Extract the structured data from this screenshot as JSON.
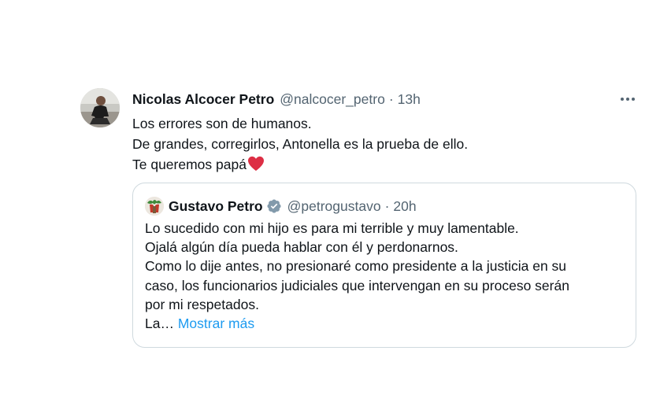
{
  "tweet": {
    "author_name": "Nicolas Alcocer Petro",
    "author_handle": "@nalcocer_petro",
    "separator": "·",
    "time": "13h",
    "lines": [
      "Los errores son de humanos.",
      "De grandes, corregirlos, Antonella es la prueba de ello.",
      "Te queremos papá"
    ],
    "emoji": "heart-icon"
  },
  "quote": {
    "author_name": "Gustavo Petro",
    "author_handle": "@petrogustavo",
    "separator": "·",
    "time": "20h",
    "verified_color": "#829aab",
    "lines": [
      "Lo sucedido con mi hijo es para mi terrible y muy lamentable.",
      "Ojalá algún día pueda hablar con él y perdonarnos.",
      "Como lo dije antes, no presionaré como presidente  a la justicia en su",
      "caso, los funcionarios judiciales que intervengan en su proceso serán",
      "por mi respetados.",
      "La…"
    ],
    "show_more_label": "Mostrar más"
  },
  "colors": {
    "text": "#0f1419",
    "secondary": "#536471",
    "link": "#1d9bf0",
    "border": "#cfd9de",
    "heart": "#f91880"
  }
}
